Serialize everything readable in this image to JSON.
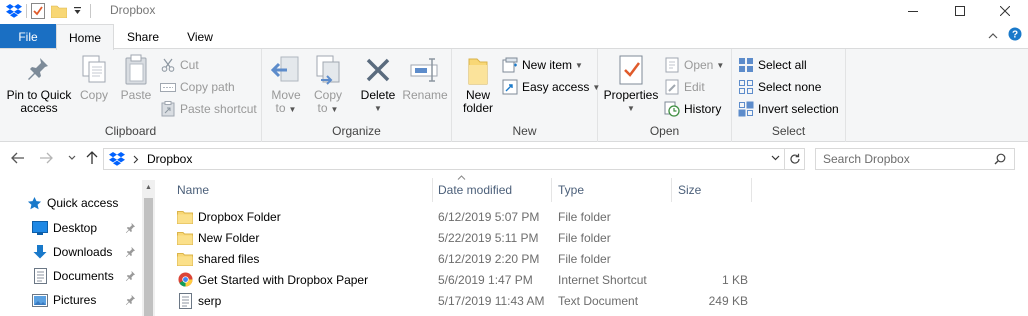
{
  "window": {
    "title": "Dropbox"
  },
  "ribbon_tabs": {
    "file": "File",
    "home": "Home",
    "share": "Share",
    "view": "View"
  },
  "clipboard": {
    "pin_label_1": "Pin to Quick",
    "pin_label_2": "access",
    "copy": "Copy",
    "paste": "Paste",
    "cut": "Cut",
    "copy_path": "Copy path",
    "paste_shortcut": "Paste shortcut",
    "group_label": "Clipboard"
  },
  "organize": {
    "move_to_1": "Move",
    "move_to_2": "to",
    "copy_to_1": "Copy",
    "copy_to_2": "to",
    "delete": "Delete",
    "rename": "Rename",
    "group_label": "Organize"
  },
  "new_group": {
    "new_folder_1": "New",
    "new_folder_2": "folder",
    "new_item": "New item",
    "easy_access": "Easy access",
    "group_label": "New"
  },
  "open_group": {
    "properties": "Properties",
    "open": "Open",
    "edit": "Edit",
    "history": "History",
    "group_label": "Open"
  },
  "select_group": {
    "select_all": "Select all",
    "select_none": "Select none",
    "invert_selection": "Invert selection",
    "group_label": "Select"
  },
  "address": {
    "path": "Dropbox",
    "search_placeholder": "Search Dropbox"
  },
  "nav_pane": {
    "quick_access": "Quick access",
    "items": [
      {
        "label": "Desktop"
      },
      {
        "label": "Downloads"
      },
      {
        "label": "Documents"
      },
      {
        "label": "Pictures"
      }
    ]
  },
  "columns": {
    "name": "Name",
    "date_modified": "Date modified",
    "type": "Type",
    "size": "Size"
  },
  "files": [
    {
      "name": "Dropbox Folder",
      "date": "6/12/2019 5:07 PM",
      "type": "File folder",
      "size": "",
      "icon": "folder-icon"
    },
    {
      "name": "New Folder",
      "date": "5/22/2019 5:11 PM",
      "type": "File folder",
      "size": "",
      "icon": "folder-icon"
    },
    {
      "name": "shared files",
      "date": "6/12/2019 2:20 PM",
      "type": "File folder",
      "size": "",
      "icon": "folder-icon"
    },
    {
      "name": "Get Started with Dropbox Paper",
      "date": "5/6/2019 1:47 PM",
      "type": "Internet Shortcut",
      "size": "1 KB",
      "icon": "chrome-shortcut-icon"
    },
    {
      "name": "serp",
      "date": "5/17/2019 11:43 AM",
      "type": "Text Document",
      "size": "249 KB",
      "icon": "text-document-icon"
    }
  ],
  "colors": {
    "file_tab": "#1a6fc3",
    "folder": "#f8d775",
    "dropbox_blue": "#0061fe",
    "accent_blue": "#1979ca"
  }
}
